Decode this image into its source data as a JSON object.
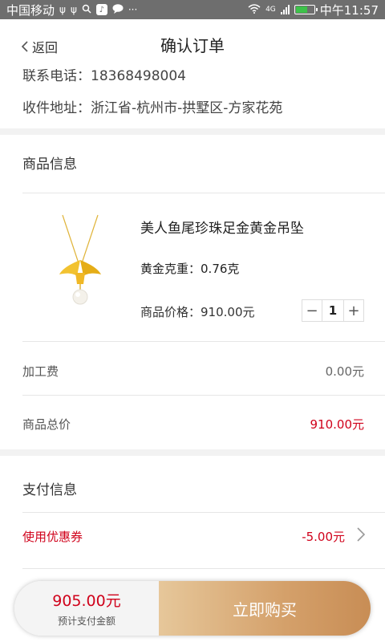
{
  "status_bar": {
    "carrier": "中国移动",
    "network": "4G",
    "time": "中午11:57"
  },
  "nav": {
    "back_label": "返回",
    "title": "确认订单"
  },
  "address": {
    "phone_label": "联系电话：18368498004",
    "address_label": "收件地址：",
    "address_value": "浙江省-杭州市-拱墅区-方家花苑"
  },
  "product_section": {
    "title": "商品信息",
    "product": {
      "name": "美人鱼尾珍珠足金黄金吊坠",
      "weight_label": "黄金克重：",
      "weight_value": "0.76克",
      "price_label": "商品价格：",
      "price_value": "910.00元",
      "quantity": "1",
      "minus": "−",
      "plus": "+"
    }
  },
  "fees": {
    "processing_label": "加工费",
    "processing_value": "0.00元",
    "total_label": "商品总价",
    "total_value": "910.00元"
  },
  "payment_section": {
    "title": "支付信息",
    "coupon_label": "使用优惠券",
    "coupon_value": "-5.00元"
  },
  "bottom_bar": {
    "amount": "905.00元",
    "amount_label": "预计支付金额",
    "buy_label": "立即购买"
  },
  "colors": {
    "accent_red": "#d0021b",
    "buy_gold": "#d4a06a",
    "status_bar_bg": "#6e6e6e"
  }
}
